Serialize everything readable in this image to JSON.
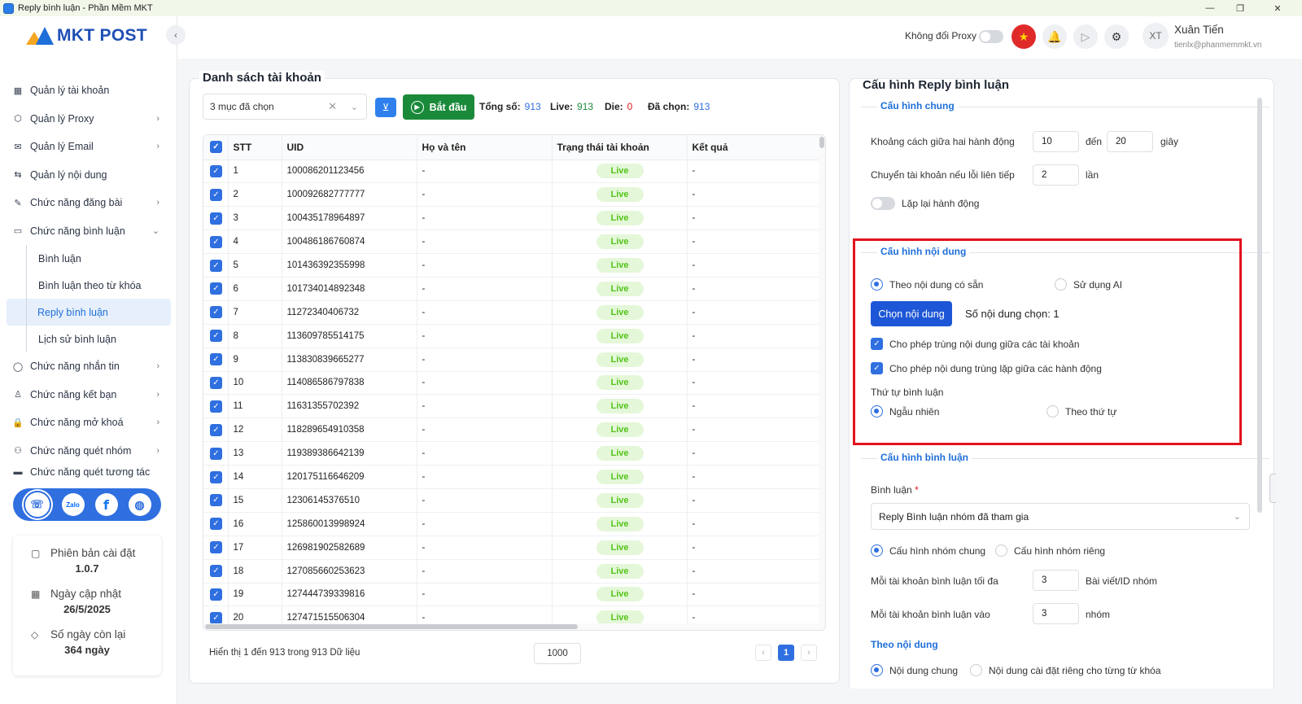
{
  "window": {
    "title": "Reply bình luận - Phần Mềm MKT",
    "minimize": "—",
    "maximize": "❐",
    "close": "✕"
  },
  "brand": {
    "logo_text": "MKT POST"
  },
  "sidebar": {
    "items": [
      {
        "label": "Quản lý tài khoản",
        "icon": "▦"
      },
      {
        "label": "Quản lý Proxy",
        "icon": "⬡",
        "chevron": "›"
      },
      {
        "label": "Quản lý Email",
        "icon": "✉",
        "chevron": "›"
      },
      {
        "label": "Quản lý nội dung",
        "icon": "⇆"
      },
      {
        "label": "Chức năng đăng bài",
        "icon": "✎",
        "chevron": "›"
      },
      {
        "label": "Chức năng bình luận",
        "icon": "▭",
        "chevron": "⌄"
      }
    ],
    "sub_items": [
      "Bình luận",
      "Bình luận theo từ khóa",
      "Reply bình luận",
      "Lịch sử bình luận"
    ],
    "items_after": [
      {
        "label": "Chức năng nhắn tin",
        "icon": "◯",
        "chevron": "›"
      },
      {
        "label": "Chức năng kết bạn",
        "icon": "♙",
        "chevron": "›"
      },
      {
        "label": "Chức năng mở khoá",
        "icon": "🔒",
        "chevron": "›"
      },
      {
        "label": "Chức năng quét nhóm",
        "icon": "⚇",
        "chevron": "›"
      },
      {
        "label": "Chức năng quét tương tác",
        "icon": "▬"
      }
    ],
    "social": {
      "zalo": "Zalo",
      "facebook": "f",
      "web": "◍",
      "support": "☏"
    },
    "version": {
      "version_label": "Phiên bản cài đặt",
      "version_value": "1.0.7",
      "update_label": "Ngày cập nhật",
      "update_value": "26/5/2025",
      "days_label": "Số ngày còn lại",
      "days_value": "364 ngày"
    }
  },
  "header": {
    "proxy_label": "Không đổi Proxy",
    "user_initials": "XT",
    "user_name": "Xuân Tiến",
    "user_email": "tienlx@phanmemmkt.vn"
  },
  "accounts": {
    "title": "Danh sách tài khoản",
    "filter_value": "3 mục đã chọn",
    "start_label": "Bắt đầu",
    "stats": {
      "total_label": "Tổng số:",
      "total_value": "913",
      "live_label": "Live:",
      "live_value": "913",
      "die_label": "Die:",
      "die_value": "0",
      "selected_label": "Đã chọn:",
      "selected_value": "913"
    },
    "columns": [
      "STT",
      "UID",
      "Họ và tên",
      "Trạng thái tài khoản",
      "Kết quả"
    ],
    "rows": [
      {
        "stt": "1",
        "uid": "100086201123456",
        "name": "-",
        "status": "Live",
        "result": "-"
      },
      {
        "stt": "2",
        "uid": "100092682777777",
        "name": "-",
        "status": "Live",
        "result": "-"
      },
      {
        "stt": "3",
        "uid": "100435178964897",
        "name": "-",
        "status": "Live",
        "result": "-"
      },
      {
        "stt": "4",
        "uid": "100486186760874",
        "name": "-",
        "status": "Live",
        "result": "-"
      },
      {
        "stt": "5",
        "uid": "101436392355998",
        "name": "-",
        "status": "Live",
        "result": "-"
      },
      {
        "stt": "6",
        "uid": "101734014892348",
        "name": "-",
        "status": "Live",
        "result": "-"
      },
      {
        "stt": "7",
        "uid": "11272340406732",
        "name": "-",
        "status": "Live",
        "result": "-"
      },
      {
        "stt": "8",
        "uid": "113609785514175",
        "name": "-",
        "status": "Live",
        "result": "-"
      },
      {
        "stt": "9",
        "uid": "113830839665277",
        "name": "-",
        "status": "Live",
        "result": "-"
      },
      {
        "stt": "10",
        "uid": "114086586797838",
        "name": "-",
        "status": "Live",
        "result": "-"
      },
      {
        "stt": "11",
        "uid": "11631355702392",
        "name": "-",
        "status": "Live",
        "result": "-"
      },
      {
        "stt": "12",
        "uid": "118289654910358",
        "name": "-",
        "status": "Live",
        "result": "-"
      },
      {
        "stt": "13",
        "uid": "119389386642139",
        "name": "-",
        "status": "Live",
        "result": "-"
      },
      {
        "stt": "14",
        "uid": "120175116646209",
        "name": "-",
        "status": "Live",
        "result": "-"
      },
      {
        "stt": "15",
        "uid": "12306145376510",
        "name": "-",
        "status": "Live",
        "result": "-"
      },
      {
        "stt": "16",
        "uid": "125860013998924",
        "name": "-",
        "status": "Live",
        "result": "-"
      },
      {
        "stt": "17",
        "uid": "126981902582689",
        "name": "-",
        "status": "Live",
        "result": "-"
      },
      {
        "stt": "18",
        "uid": "127085660253623",
        "name": "-",
        "status": "Live",
        "result": "-"
      },
      {
        "stt": "19",
        "uid": "127444739339816",
        "name": "-",
        "status": "Live",
        "result": "-"
      },
      {
        "stt": "20",
        "uid": "127471515506304",
        "name": "-",
        "status": "Live",
        "result": "-"
      }
    ],
    "pager_text": "Hiển thị 1 đến 913 trong 913 Dữ liệu",
    "page_size": "1000",
    "current_page": "1",
    "prev": "‹",
    "next": "›"
  },
  "config": {
    "title": "Cấu hình Reply bình luận",
    "general": {
      "title": "Cấu hình chung",
      "delay_label": "Khoảng cách giữa hai hành động",
      "delay_from": "10",
      "to_label": "đến",
      "delay_to": "20",
      "seconds_label": "giây",
      "switch_label": "Chuyển tài khoản nếu lỗi liên tiếp",
      "switch_value": "2",
      "times_label": "lần",
      "repeat_label": "Lặp lại hành động"
    },
    "content": {
      "title": "Cấu hình nội dung",
      "opt_existing": "Theo nội dung có sẵn",
      "opt_ai": "Sử dụng AI",
      "choose_button": "Chọn nội dung",
      "selected_count": "Số nội dung chọn: 1",
      "allow_dup_accounts": "Cho phép trùng nội dung giữa các tài khoản",
      "allow_dup_actions": "Cho phép nội dung trùng lặp giữa các hành động",
      "order_label": "Thứ tự bình luận",
      "order_random": "Ngẫu nhiên",
      "order_sequential": "Theo thứ tự"
    },
    "comment": {
      "title": "Cấu hình bình luận",
      "comment_label": "Bình luận",
      "required_mark": "*",
      "comment_value": "Reply Bình luận nhóm đã tham gia",
      "opt_group_common": "Cấu hình nhóm chung",
      "opt_group_private": "Cấu hình nhóm riêng",
      "max_label": "Mỗi tài khoản bình luận tối đa",
      "max_value": "3",
      "max_unit": "Bài viết/ID nhóm",
      "into_label": "Mỗi tài khoản bình luận vào",
      "into_value": "3",
      "into_unit": "nhóm",
      "by_content_label": "Theo nội dung",
      "opt_content_common": "Nội dung chung",
      "opt_content_keyword": "Nội dung cài đặt riêng cho từng từ khóa"
    }
  }
}
